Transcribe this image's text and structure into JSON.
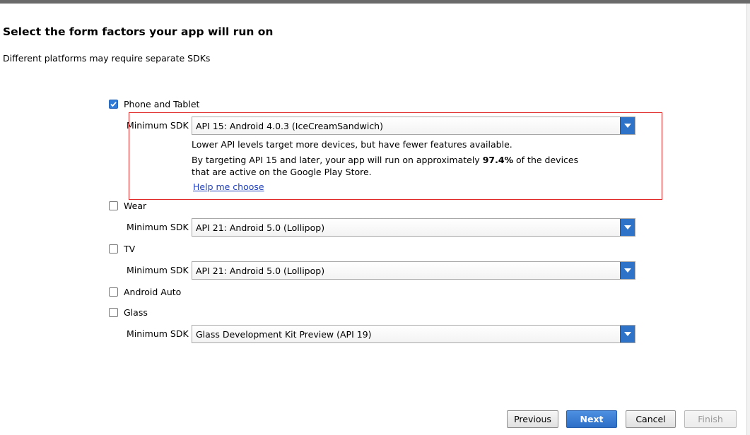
{
  "header": {
    "title": "Select the form factors your app will run on",
    "subtitle": "Different platforms may require separate SDKs"
  },
  "form_factors": {
    "phone": {
      "label": "Phone and Tablet",
      "checked": true,
      "sdk_label": "Minimum SDK",
      "sdk_value": "API 15: Android 4.0.3 (IceCreamSandwich)"
    },
    "wear": {
      "label": "Wear",
      "checked": false,
      "sdk_label": "Minimum SDK",
      "sdk_value": "API 21: Android 5.0 (Lollipop)"
    },
    "tv": {
      "label": "TV",
      "checked": false,
      "sdk_label": "Minimum SDK",
      "sdk_value": "API 21: Android 5.0 (Lollipop)"
    },
    "auto": {
      "label": "Android Auto",
      "checked": false
    },
    "glass": {
      "label": "Glass",
      "checked": false,
      "sdk_label": "Minimum SDK",
      "sdk_value": "Glass Development Kit Preview (API 19)"
    }
  },
  "info": {
    "line1": "Lower API levels target more devices, but have fewer features available.",
    "line2_pre": "By targeting API 15 and later, your app will run on approximately ",
    "line2_pct": "97.4%",
    "line2_post": " of the devices",
    "line3": "that are active on the Google Play Store.",
    "help_link": "Help me choose"
  },
  "buttons": {
    "previous": "Previous",
    "next": "Next",
    "cancel": "Cancel",
    "finish": "Finish"
  },
  "colors": {
    "accent": "#2f73c9",
    "highlight_border": "#e02a2a",
    "link": "#1f3fbf"
  }
}
